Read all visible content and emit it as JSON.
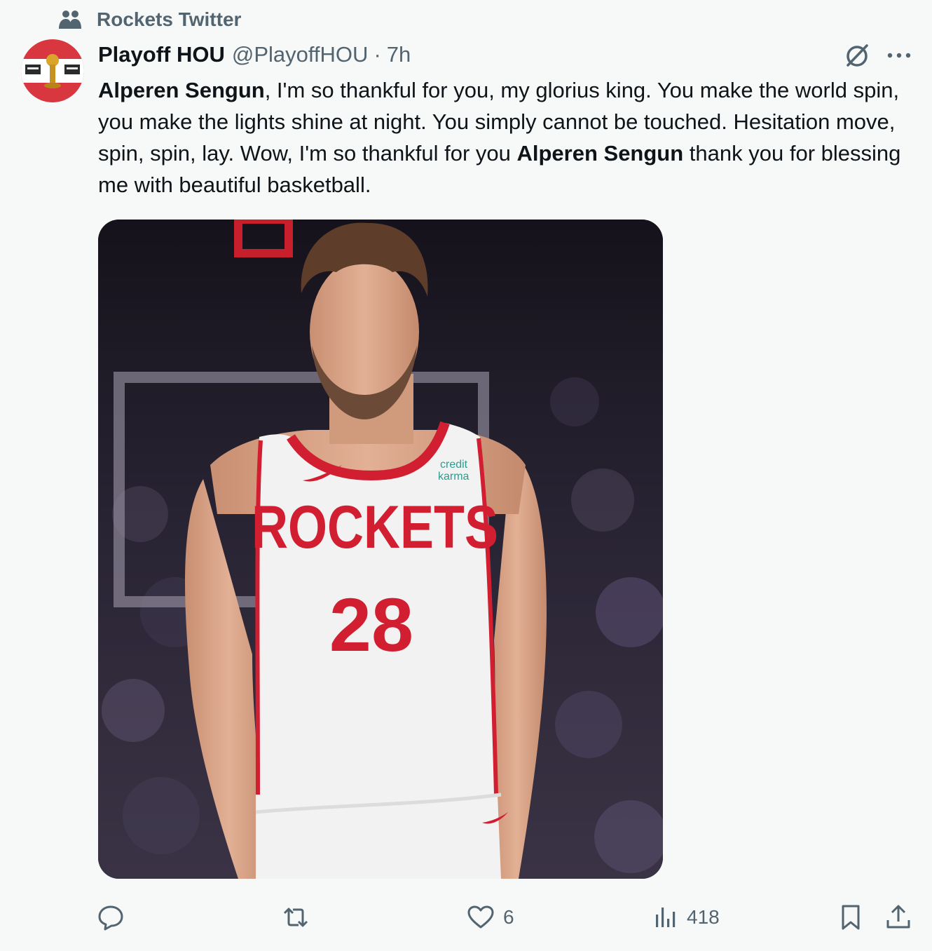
{
  "social_context": {
    "icon": "community-icon",
    "label": "Rockets Twitter"
  },
  "author": {
    "display_name": "Playoff HOU",
    "handle": "@PlayoffHOU",
    "separator": "·",
    "time": "7h",
    "avatar_icon": "trophy-avatar-icon"
  },
  "tweet": {
    "mention_1": "Alperen Sengun",
    "text_1": ", I'm so thankful for you, my glorius king. You make the world spin, you make the lights shine at night. You simply cannot be touched. Hesitation move, spin, spin, lay. Wow, I'm so thankful for you ",
    "mention_2": "Alperen Sengun",
    "text_2": " thank you for blessing me with beautiful basketball."
  },
  "media": {
    "jersey_team": "ROCKETS",
    "jersey_number": "28",
    "sponsor_line_1": "credit",
    "sponsor_line_2": "karma"
  },
  "actions": {
    "reply_count": "",
    "retweet_count": "",
    "like_count": "6",
    "views_count": "418"
  },
  "colors": {
    "icon_gray": "#536471",
    "text": "#0f1419",
    "background": "#f7f9f9",
    "rockets_red": "#ce1141"
  }
}
